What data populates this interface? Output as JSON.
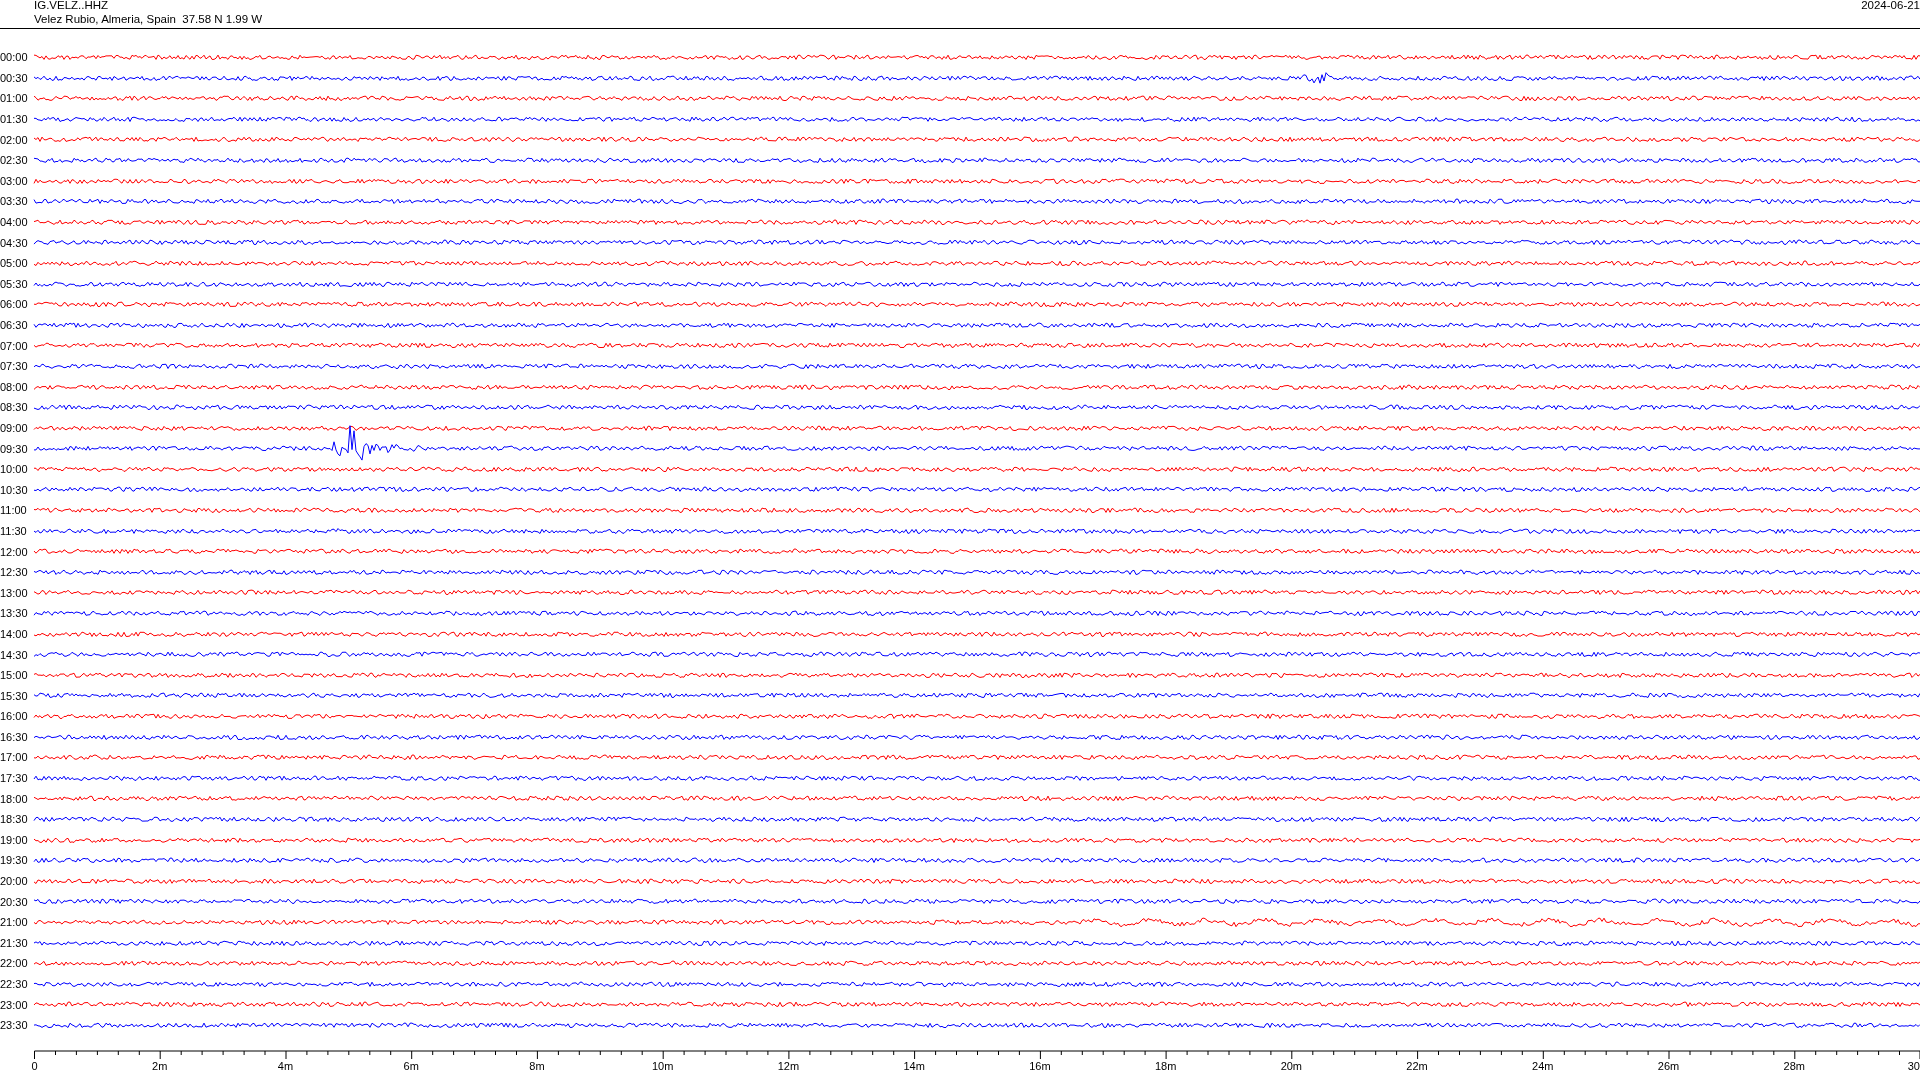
{
  "header": {
    "station": "IG.VELZ..HHZ",
    "location": "Velez Rubio, Almeria, Spain  37.58 N 1.99 W",
    "date": "2024-06-21"
  },
  "rows": [
    {
      "time": "00:00",
      "color": "#ff0000"
    },
    {
      "time": "00:30",
      "color": "#0000ff"
    },
    {
      "time": "01:00",
      "color": "#ff0000"
    },
    {
      "time": "01:30",
      "color": "#0000ff"
    },
    {
      "time": "02:00",
      "color": "#ff0000"
    },
    {
      "time": "02:30",
      "color": "#0000ff"
    },
    {
      "time": "03:00",
      "color": "#ff0000"
    },
    {
      "time": "03:30",
      "color": "#0000ff"
    },
    {
      "time": "04:00",
      "color": "#ff0000"
    },
    {
      "time": "04:30",
      "color": "#0000ff"
    },
    {
      "time": "05:00",
      "color": "#ff0000"
    },
    {
      "time": "05:30",
      "color": "#0000ff"
    },
    {
      "time": "06:00",
      "color": "#ff0000"
    },
    {
      "time": "06:30",
      "color": "#0000ff"
    },
    {
      "time": "07:00",
      "color": "#ff0000"
    },
    {
      "time": "07:30",
      "color": "#0000ff"
    },
    {
      "time": "08:00",
      "color": "#ff0000"
    },
    {
      "time": "08:30",
      "color": "#0000ff"
    },
    {
      "time": "09:00",
      "color": "#ff0000"
    },
    {
      "time": "09:30",
      "color": "#0000ff"
    },
    {
      "time": "10:00",
      "color": "#ff0000"
    },
    {
      "time": "10:30",
      "color": "#0000ff"
    },
    {
      "time": "11:00",
      "color": "#ff0000"
    },
    {
      "time": "11:30",
      "color": "#0000ff"
    },
    {
      "time": "12:00",
      "color": "#ff0000"
    },
    {
      "time": "12:30",
      "color": "#0000ff"
    },
    {
      "time": "13:00",
      "color": "#ff0000"
    },
    {
      "time": "13:30",
      "color": "#0000ff"
    },
    {
      "time": "14:00",
      "color": "#ff0000"
    },
    {
      "time": "14:30",
      "color": "#0000ff"
    },
    {
      "time": "15:00",
      "color": "#ff0000"
    },
    {
      "time": "15:30",
      "color": "#0000ff"
    },
    {
      "time": "16:00",
      "color": "#ff0000"
    },
    {
      "time": "16:30",
      "color": "#0000ff"
    },
    {
      "time": "17:00",
      "color": "#ff0000"
    },
    {
      "time": "17:30",
      "color": "#0000ff"
    },
    {
      "time": "18:00",
      "color": "#ff0000"
    },
    {
      "time": "18:30",
      "color": "#0000ff"
    },
    {
      "time": "19:00",
      "color": "#ff0000"
    },
    {
      "time": "19:30",
      "color": "#0000ff"
    },
    {
      "time": "20:00",
      "color": "#ff0000"
    },
    {
      "time": "20:30",
      "color": "#0000ff"
    },
    {
      "time": "21:00",
      "color": "#ff0000"
    },
    {
      "time": "21:30",
      "color": "#0000ff"
    },
    {
      "time": "22:00",
      "color": "#ff0000"
    },
    {
      "time": "22:30",
      "color": "#0000ff"
    },
    {
      "time": "23:00",
      "color": "#ff0000"
    },
    {
      "time": "23:30",
      "color": "#0000ff"
    }
  ],
  "x_axis": {
    "labels": [
      "0",
      "2m",
      "4m",
      "6m",
      "8m",
      "10m",
      "12m",
      "14m",
      "16m",
      "18m",
      "20m",
      "22m",
      "24m",
      "26m",
      "28m",
      "30"
    ]
  }
}
